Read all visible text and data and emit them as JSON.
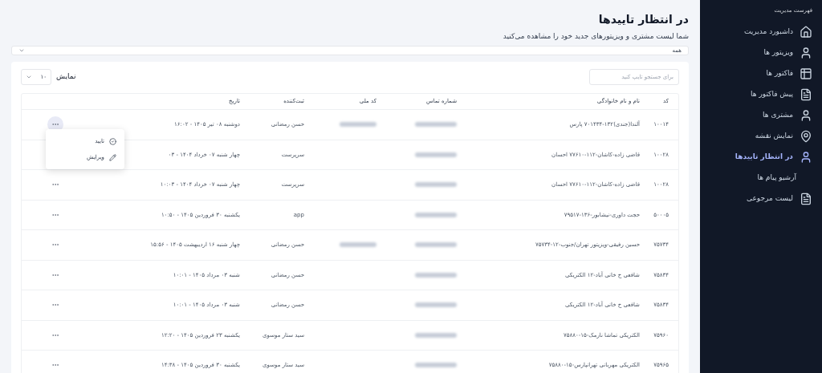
{
  "sidebar": {
    "title": "فهرست مدیریت",
    "items": [
      {
        "label": "داشبورد مدیریت",
        "kind": "home",
        "selected": false
      },
      {
        "label": "ویزیتور ها",
        "kind": "person",
        "selected": false
      },
      {
        "label": "فاکتور ها",
        "kind": "invoice",
        "selected": false
      },
      {
        "label": "پیش فاکتور ها",
        "kind": "document",
        "selected": false
      },
      {
        "label": "مشتری ها",
        "kind": "person",
        "selected": false
      },
      {
        "label": "نمایش نقشه",
        "kind": "pin",
        "selected": false
      },
      {
        "label": "در انتظار تاییدها",
        "kind": "person",
        "selected": true
      },
      {
        "label": "آرشیو پیام ها",
        "kind": "plain",
        "selected": false
      },
      {
        "label": "لیست مرجوعی",
        "kind": "document",
        "selected": false
      }
    ]
  },
  "header": {
    "title": "در انتظار تاییدها",
    "subtitle": "شما لیست مشتری و ویزیتورهای جدید خود را مشاهده می‌کنید"
  },
  "filter": {
    "value": "همه"
  },
  "search": {
    "placeholder": "برای جستجو تایپ کنید"
  },
  "page_size": {
    "label": "نمایش",
    "value": "۱۰"
  },
  "table": {
    "columns": [
      "کد",
      "نام و نام خانوادگی",
      "شماره تماس",
      "کد ملی",
      "ثبت‌کننده",
      "تاریخ"
    ],
    "rows": [
      {
        "code": "۱۰۰۱۴",
        "name": "آلندا(جندی)۱۳۲-۷۰۱۴۳۴ پارس",
        "phone_redacted": true,
        "national_id_redacted": true,
        "registrar": "حسن رمضانی",
        "date": "دوشنبه ۰۸ تیر ۱۴۰۵ - ۱۶:۰۲",
        "menu_open": true,
        "actions_visible": true
      },
      {
        "code": "۱۰۰۲۸",
        "name": "قاضی زاده-کاشان-۱۱۲-۷۷۶۱۰ احسان",
        "phone_redacted": true,
        "national_id_redacted": false,
        "registrar": "سرپرست",
        "date": "چهار شنبه ۰۷ خرداد ۱۴۰۴ - ۰۳",
        "menu_open": false,
        "actions_visible": false
      },
      {
        "code": "۱۰۰۲۸",
        "name": "قاضی زاده-کاشان-۱۱۲-۷۷۶۱۰ احسان",
        "phone_redacted": true,
        "national_id_redacted": false,
        "registrar": "سرپرست",
        "date": "چهار شنبه ۰۷ خرداد ۱۴۰۴ - ۱۰:۰۳",
        "menu_open": false,
        "actions_visible": true
      },
      {
        "code": "۵۰۰۰۵",
        "name": "حجت داوری-نیشابور-۱۳۶-۷۹۵۱۷",
        "phone_redacted": true,
        "national_id_redacted": false,
        "registrar": "app",
        "date": "یکشنبه ۳۰ فروردین ۱۴۰۵ - ۱۰:۵۰",
        "menu_open": false,
        "actions_visible": true
      },
      {
        "code": "۷۵۷۳۴",
        "name": "حسین رفیقی-ویزیتور تهران/جنوب-۱۲-۷۵۷۳۴",
        "phone_redacted": true,
        "national_id_redacted": true,
        "registrar": "حسن رمضانی",
        "date": "چهار شنبه ۱۶ اردیبهشت ۱۴۰۵ - ۱۵:۵۶",
        "menu_open": false,
        "actions_visible": true
      },
      {
        "code": "۷۵۸۳۴",
        "name": "شافعی خ خانی آباد-۱۲ الکتریکی",
        "phone_redacted": true,
        "national_id_redacted": false,
        "registrar": "حسن رمضانی",
        "date": "شنبه ۰۳ مرداد ۱۴۰۵ - ۱۰:۰۱",
        "menu_open": false,
        "actions_visible": true
      },
      {
        "code": "۷۵۸۳۴",
        "name": "شافعی خ خانی آباد-۱۲ الکتریکی",
        "phone_redacted": true,
        "national_id_redacted": false,
        "registrar": "حسن رمضانی",
        "date": "شنبه ۰۳ مرداد ۱۴۰۵ - ۱۰:۰۱",
        "menu_open": false,
        "actions_visible": true
      },
      {
        "code": "۷۵۹۶۰",
        "name": "الکتریکی تماشا نارمک-۱۵-۷۵۸۸۰",
        "phone_redacted": true,
        "national_id_redacted": false,
        "registrar": "سید ستار موسوی",
        "date": "یکشنبه ۲۳ فروردین ۱۴۰۵ - ۱۲:۲۰",
        "menu_open": false,
        "actions_visible": true
      },
      {
        "code": "۷۵۹۶۵",
        "name": "الکتریکی مهربانی تهرانپارس-۱۵-۷۵۸۸۰",
        "phone_redacted": true,
        "national_id_redacted": false,
        "registrar": "سید ستار موسوی",
        "date": "یکشنبه ۳۰ فروردین ۱۴۰۵ - ۱۴:۳۸",
        "menu_open": false,
        "actions_visible": true
      }
    ]
  },
  "row_menu": {
    "items": [
      {
        "label": "تایید",
        "kind": "check"
      },
      {
        "label": "ویرایش",
        "kind": "edit"
      }
    ]
  }
}
